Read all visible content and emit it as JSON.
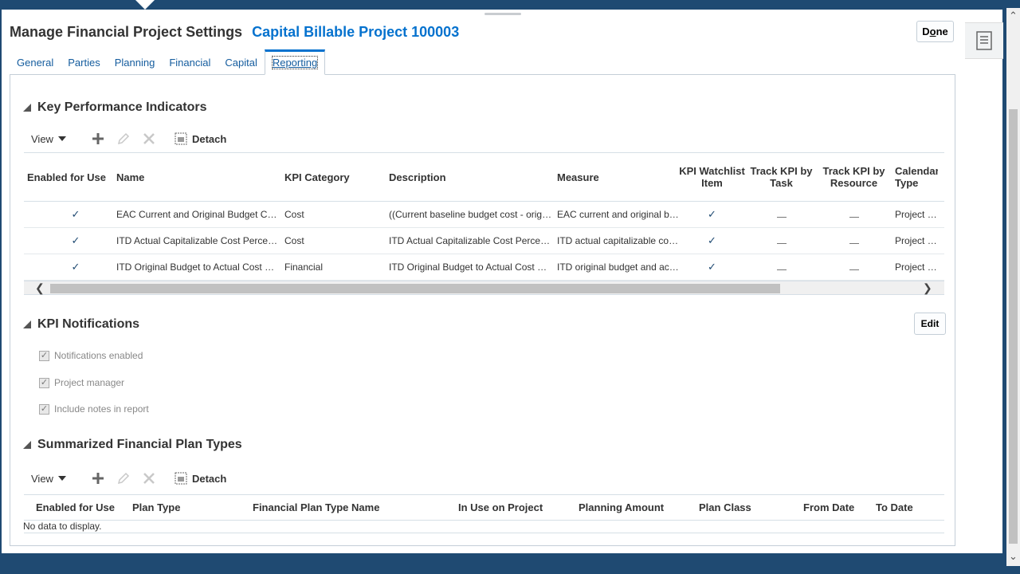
{
  "header": {
    "title": "Manage Financial Project Settings",
    "project": "Capital Billable Project 100003",
    "done_label": "Done",
    "done_mnemonic": "o"
  },
  "tabs": [
    {
      "label": "General"
    },
    {
      "label": "Parties"
    },
    {
      "label": "Planning"
    },
    {
      "label": "Financial"
    },
    {
      "label": "Capital"
    },
    {
      "label": "Reporting",
      "active": true
    }
  ],
  "kpi": {
    "title": "Key Performance Indicators",
    "view_label": "View",
    "detach_label": "Detach",
    "columns": {
      "enabled": "Enabled for Use",
      "name": "Name",
      "category": "KPI Category",
      "description": "Description",
      "measure": "Measure",
      "watchlist": "KPI Watchlist Item",
      "track_task": "Track KPI by Task",
      "track_resource": "Track KPI by Resource",
      "calendar": "Calendar Type"
    },
    "rows": [
      {
        "enabled": "✓",
        "name": "EAC Current and Original Budget Cost Variance",
        "category": "Cost",
        "description": "((Current baseline budget cost - original budget cost)",
        "measure": "EAC current and original budget cost variance",
        "watchlist": "✓",
        "calendar": "Project accounting"
      },
      {
        "enabled": "✓",
        "name": "ITD Actual Capitalizable Cost Percentage",
        "category": "Cost",
        "description": "ITD Actual Capitalizable Cost Percentage",
        "measure": "ITD actual capitalizable cost percentage",
        "watchlist": "✓",
        "calendar": "Project accounting"
      },
      {
        "enabled": "✓",
        "name": "ITD Original Budget to Actual Cost Variance",
        "category": "Financial",
        "description": "ITD Original Budget to Actual Cost Variance",
        "measure": "ITD original budget and actual cost variance",
        "watchlist": "✓",
        "calendar": "Project accounting"
      }
    ]
  },
  "notifications": {
    "title": "KPI Notifications",
    "edit_label": "Edit",
    "items": [
      {
        "label": "Notifications enabled",
        "checked": true
      },
      {
        "label": "Project manager",
        "checked": true
      },
      {
        "label": "Include notes in report",
        "checked": true
      }
    ]
  },
  "plan_types": {
    "title": "Summarized Financial Plan Types",
    "view_label": "View",
    "detach_label": "Detach",
    "columns": {
      "enabled": "Enabled for Use",
      "plan_type": "Plan Type",
      "name": "Financial Plan Type Name",
      "in_use": "In Use on Project",
      "amount": "Planning Amount",
      "plan_class": "Plan Class",
      "from": "From Date",
      "to": "To Date"
    },
    "empty_text": "No data to display."
  },
  "icons": {
    "add": "plus-icon",
    "edit": "pencil-icon",
    "delete": "x-icon",
    "detach": "detach-icon",
    "side": "document-panel-icon"
  }
}
